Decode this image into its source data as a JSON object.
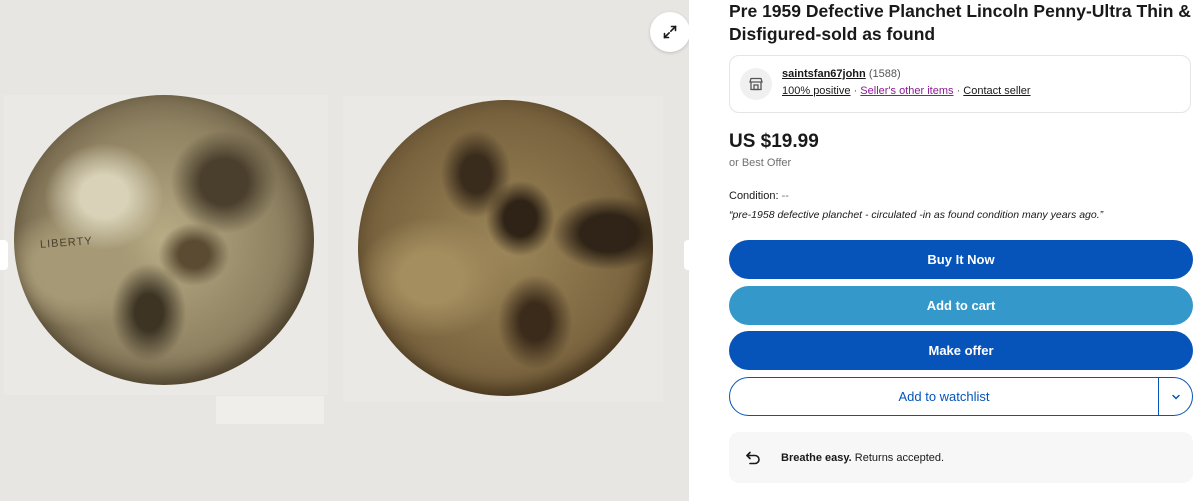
{
  "listing": {
    "title": "Pre 1959 Defective Planchet Lincoln Penny-Ultra Thin & Disfigured-sold as found"
  },
  "gallery": {
    "coin_inscription": "LIBERTY",
    "expand_icon": "expand-arrows-icon"
  },
  "seller": {
    "icon": "store-icon",
    "name": "saintsfan67john",
    "feedback_count": "(1588)",
    "positive": "100% positive",
    "other_items": "Seller's other items",
    "contact": "Contact seller",
    "separator": "·"
  },
  "pricing": {
    "price": "US $19.99",
    "best_offer": "or Best Offer"
  },
  "condition": {
    "label": "Condition:",
    "value": "--",
    "description": "“pre-1958 defective planchet - circulated -in as found condition many years ago.”"
  },
  "actions": {
    "buy_now": "Buy It Now",
    "add_to_cart": "Add to cart",
    "make_offer": "Make offer",
    "add_to_watchlist": "Add to watchlist",
    "watchlist_caret_icon": "chevron-down-icon"
  },
  "returns": {
    "icon": "return-arrow-icon",
    "bold": "Breathe easy.",
    "text": " Returns accepted."
  },
  "colors": {
    "primary_button": "#0654ba",
    "secondary_button": "#3498ca",
    "link_visited": "#8b1b96"
  }
}
